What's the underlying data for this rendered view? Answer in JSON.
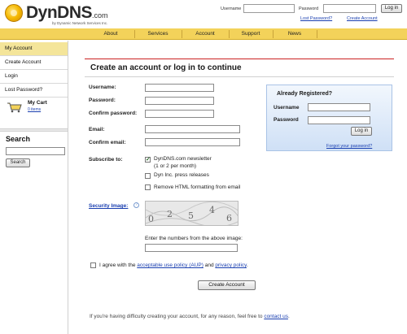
{
  "brand": {
    "name": "DynDNS",
    "suffix": ".com",
    "tagline": "by Dynamic Network Services Inc."
  },
  "header": {
    "username_label": "Username",
    "password_label": "Password",
    "login_button": "Log in",
    "lost_password": "Lost Password?",
    "create_account": "Create Account"
  },
  "nav": {
    "items": [
      "About",
      "Services",
      "Account",
      "Support",
      "News"
    ]
  },
  "sidebar": {
    "items": [
      "My Account",
      "Create Account",
      "Login",
      "Lost Password?"
    ],
    "cart_title": "My Cart",
    "cart_count": "0 items",
    "search_title": "Search",
    "search_button": "Search"
  },
  "form": {
    "title": "Create an account or log in to continue",
    "username": "Username:",
    "password": "Password:",
    "confirm_password": "Confirm password:",
    "email": "Email:",
    "confirm_email": "Confirm email:",
    "subscribe_to": "Subscribe to:",
    "newsletter": "DynDNS.com newsletter",
    "newsletter_freq": "(1 or 2 per month)",
    "press_releases": "Dyn Inc. press releases",
    "remove_html": "Remove HTML formatting from email",
    "security_image": "Security Image:",
    "captcha_digits": [
      "0",
      "2",
      "5",
      "4",
      "6"
    ],
    "captcha_hint": "Enter the numbers from the above image:",
    "agree_prefix": "I agree with the",
    "aup_link": "acceptable use policy (AUP)",
    "agree_and": "and",
    "privacy_link": "privacy policy",
    "agree_suffix": ".",
    "create_button": "Create Account"
  },
  "registered": {
    "title": "Already Registered?",
    "username": "Username",
    "password": "Password",
    "login_button": "Log in",
    "forgot": "Forgot your password?"
  },
  "footer": {
    "text": "If you're having difficulty creating your account, for any reason, feel free to",
    "link": "contact us",
    "end": "."
  }
}
